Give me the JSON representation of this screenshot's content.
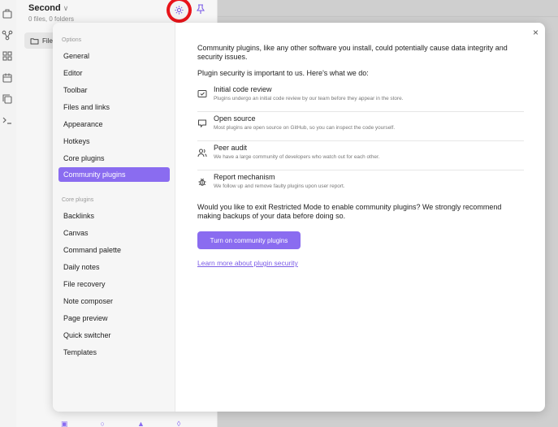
{
  "vault": {
    "name": "Second",
    "counts": "0 files, 0 folders"
  },
  "explorer": {
    "files_tab_label": "Files"
  },
  "ribbon_icons": [
    "switch-vault-icon",
    "graph-icon",
    "canvas-icon",
    "calendar-icon",
    "copy-icon",
    "terminal-icon"
  ],
  "settings": {
    "sidebar": {
      "options_heading": "Options",
      "options": [
        "General",
        "Editor",
        "Toolbar",
        "Files and links",
        "Appearance",
        "Hotkeys",
        "Core plugins",
        "Community plugins"
      ],
      "active": "Community plugins",
      "core_heading": "Core plugins",
      "core_plugins": [
        "Backlinks",
        "Canvas",
        "Command palette",
        "Daily notes",
        "File recovery",
        "Note composer",
        "Page preview",
        "Quick switcher",
        "Templates"
      ]
    },
    "community": {
      "warning": "Community plugins, like any other software you install, could potentially cause data integrity and security issues.",
      "intro": "Plugin security is important to us. Here's what we do:",
      "features": [
        {
          "icon": "review-icon",
          "title": "Initial code review",
          "desc": "Plugins undergo an initial code review by our team before they appear in the store."
        },
        {
          "icon": "open-source-icon",
          "title": "Open source",
          "desc": "Most plugins are open source on GitHub, so you can inspect the code yourself."
        },
        {
          "icon": "peer-audit-icon",
          "title": "Peer audit",
          "desc": "We have a large community of developers who watch out for each other."
        },
        {
          "icon": "bug-icon",
          "title": "Report mechanism",
          "desc": "We follow up and remove faulty plugins upon user report."
        }
      ],
      "question": "Would you like to exit Restricted Mode to enable community plugins? We strongly recommend making backups of your data before doing so.",
      "button_label": "Turn on community plugins",
      "learn_more": "Learn more about plugin security"
    },
    "close_symbol": "×"
  },
  "colors": {
    "accent": "#8a6cf0",
    "highlight_ring": "#e8141a"
  }
}
